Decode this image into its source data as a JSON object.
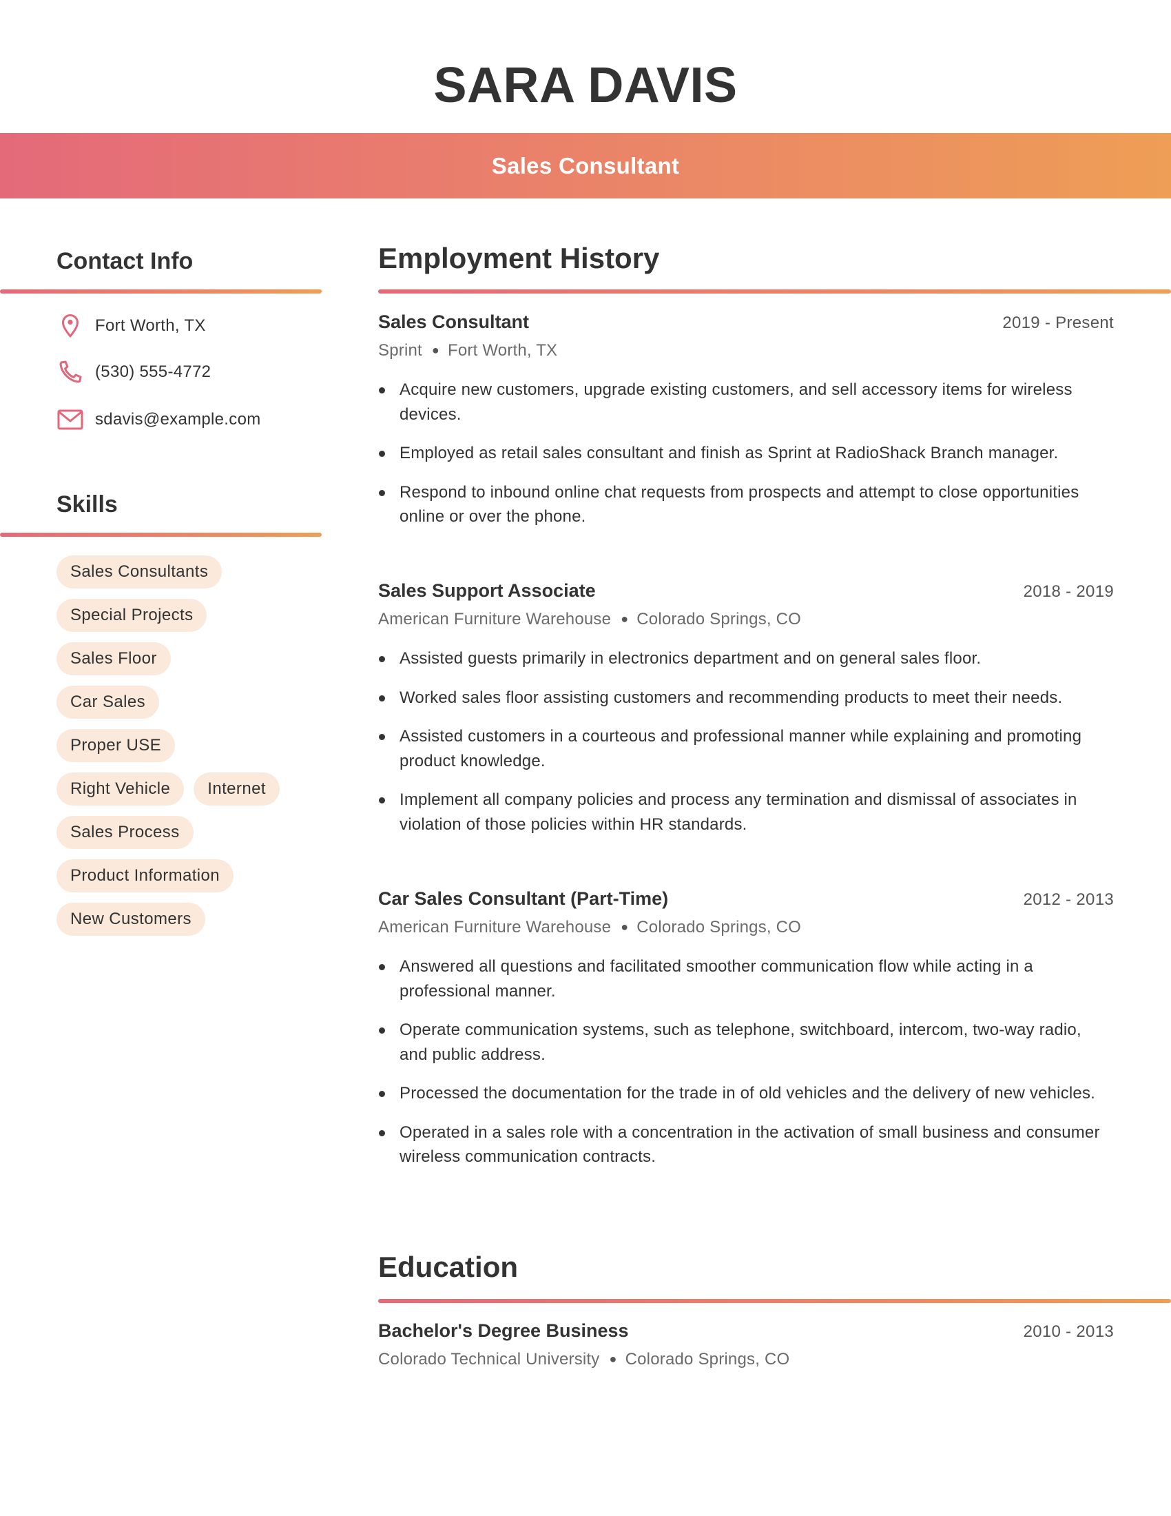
{
  "header": {
    "name": "SARA DAVIS",
    "job_title": "Sales Consultant"
  },
  "colors": {
    "gradient_start": "#E46A7A",
    "gradient_end": "#EE9E55",
    "chip_bg": "#FBEADC",
    "icon": "#E2677A",
    "text": "#333333"
  },
  "sidebar": {
    "contact": {
      "heading": "Contact Info",
      "items": [
        {
          "icon": "map-pin-icon",
          "text": "Fort Worth, TX"
        },
        {
          "icon": "phone-icon",
          "text": "(530) 555-4772"
        },
        {
          "icon": "mail-icon",
          "text": "sdavis@example.com"
        }
      ]
    },
    "skills": {
      "heading": "Skills",
      "items": [
        "Sales Consultants",
        "Special Projects",
        "Sales Floor",
        "Car Sales",
        "Proper USE",
        "Right Vehicle",
        "Internet",
        "Sales Process",
        "Product Information",
        "New Customers"
      ]
    }
  },
  "employment": {
    "heading": "Employment History",
    "jobs": [
      {
        "title": "Sales Consultant",
        "dates": "2019 - Present",
        "company": "Sprint",
        "location": "Fort Worth, TX",
        "bullets": [
          "Acquire new customers, upgrade existing customers, and sell accessory items for wireless devices.",
          "Employed as retail sales consultant and finish as Sprint at RadioShack Branch manager.",
          "Respond to inbound online chat requests from prospects and attempt to close opportunities online or over the phone."
        ]
      },
      {
        "title": "Sales Support Associate",
        "dates": "2018 - 2019",
        "company": "American Furniture Warehouse",
        "location": "Colorado Springs, CO",
        "bullets": [
          "Assisted guests primarily in electronics department and on general sales floor.",
          "Worked sales floor assisting customers and recommending products to meet their needs.",
          "Assisted customers in a courteous and professional manner while explaining and promoting product knowledge.",
          "Implement all company policies and process any termination and dismissal of associates in violation of those policies within HR standards."
        ]
      },
      {
        "title": "Car Sales Consultant (Part-Time)",
        "dates": "2012 - 2013",
        "company": "American Furniture Warehouse",
        "location": "Colorado Springs, CO",
        "bullets": [
          "Answered all questions and facilitated smoother communication flow while acting in a professional manner.",
          "Operate communication systems, such as telephone, switchboard, intercom, two-way radio, and public address.",
          "Processed the documentation for the trade in of old vehicles and the delivery of new vehicles.",
          "Operated in a sales role with a concentration in the activation of small business and consumer wireless communication contracts."
        ]
      }
    ]
  },
  "education": {
    "heading": "Education",
    "items": [
      {
        "degree": "Bachelor's Degree Business",
        "dates": "2010 - 2013",
        "school": "Colorado Technical University",
        "location": "Colorado Springs, CO"
      }
    ]
  }
}
